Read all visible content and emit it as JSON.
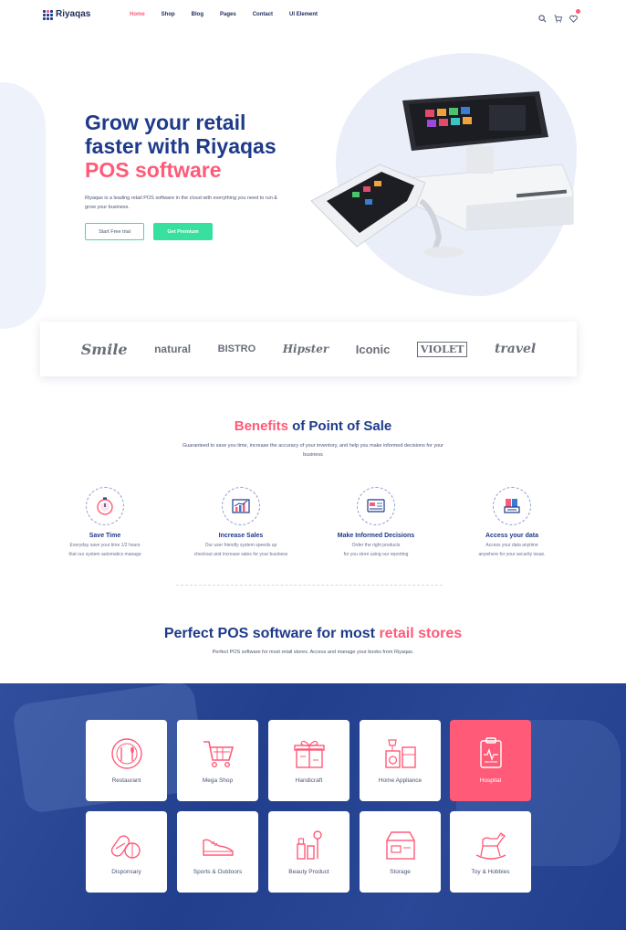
{
  "nav": {
    "logo": "Riyaqas",
    "menu": [
      "Home",
      "Shop",
      "Blog",
      "Pages",
      "Contact",
      "UI Element"
    ],
    "active_index": 0,
    "icons": [
      "search-icon",
      "cart-icon",
      "heart-icon"
    ]
  },
  "hero": {
    "title_line1": "Grow your retail",
    "title_line2": "faster with Riyaqas",
    "title_line3": "POS software",
    "description": "Riyaqas is a leading retail POS software in the cloud with everything you need to run & grow your business.",
    "btn_trial": "Start Free trial",
    "btn_premium": "Get Premium"
  },
  "brands": [
    "Smile",
    "natural",
    "BISTRO",
    "Hipster",
    "Iconic",
    "VIOLET",
    "travel"
  ],
  "benefits": {
    "title_pink": "Benefits",
    "title_rest": " of Point of Sale",
    "subtitle": "Guaranteed to save you time, increase the accuracy of your inventory, and help you make informed decisions for your business",
    "items": [
      {
        "title": "Save Time",
        "desc": "Everyday save your time 1/2 hours\nthat our system automatics manage",
        "icon": "stopwatch-icon"
      },
      {
        "title": "Increase Sales",
        "desc": "Our user friendly system speeds up\ncheckout and increase sales for your business",
        "icon": "chart-icon"
      },
      {
        "title": "Make Informed Decisions",
        "desc": "Order the right products\nfor you store using our reporting",
        "icon": "report-icon"
      },
      {
        "title": "Access your data",
        "desc": "Access your data anytime\nanywhere for your security issue.",
        "icon": "data-icon"
      }
    ]
  },
  "pos": {
    "title_main": "Perfect POS software for most ",
    "title_pink": "retail stores",
    "subtitle": "Perfect POS software for most retail stores. Access and manage your books from Riyaqas."
  },
  "categories": [
    {
      "label": "Restaurant",
      "icon": "plate-icon"
    },
    {
      "label": "Mega Shop",
      "icon": "cart-icon"
    },
    {
      "label": "Handicraft",
      "icon": "gift-icon"
    },
    {
      "label": "Home Appliance",
      "icon": "appliance-icon"
    },
    {
      "label": "Hospital",
      "icon": "clipboard-icon"
    },
    {
      "label": "Disponsary",
      "icon": "pills-icon"
    },
    {
      "label": "Sports & Outdoors",
      "icon": "shoe-icon"
    },
    {
      "label": "Beauty Product",
      "icon": "cosmetics-icon"
    },
    {
      "label": "Storage",
      "icon": "box-icon"
    },
    {
      "label": "Toy & Hobbies",
      "icon": "rocking-horse-icon"
    }
  ],
  "colors": {
    "primary": "#1e3a8a",
    "accent": "#ff5a78",
    "green": "#38e0a0",
    "section_bg": "#213f8c"
  }
}
